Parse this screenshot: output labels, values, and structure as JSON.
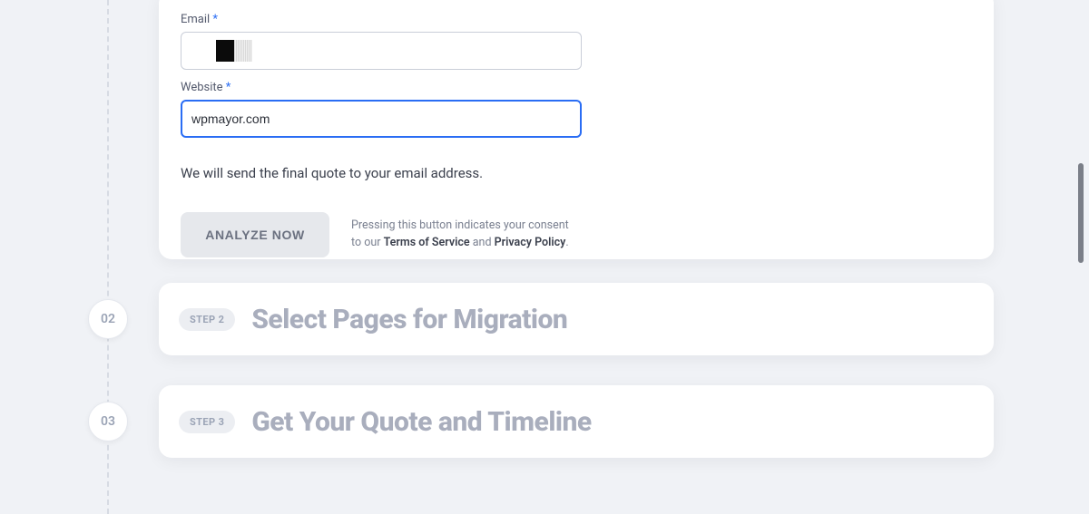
{
  "form": {
    "email_label": "Email",
    "website_label": "Website",
    "required_star": "*",
    "email_value": "",
    "website_value": "wpmayor.com",
    "info_line": "We will send the final quote to your email address.",
    "analyze_btn": "ANALYZE NOW",
    "consent_prefix": "Pressing this button indicates your consent to our ",
    "tos_label": "Terms of Service",
    "consent_and": " and ",
    "privacy_label": "Privacy Policy",
    "consent_suffix": "."
  },
  "steps": {
    "s2_num": "02",
    "s2_pill": "STEP 2",
    "s2_title": "Select Pages for Migration",
    "s3_num": "03",
    "s3_pill": "STEP 3",
    "s3_title": "Get Your Quote and Timeline"
  }
}
